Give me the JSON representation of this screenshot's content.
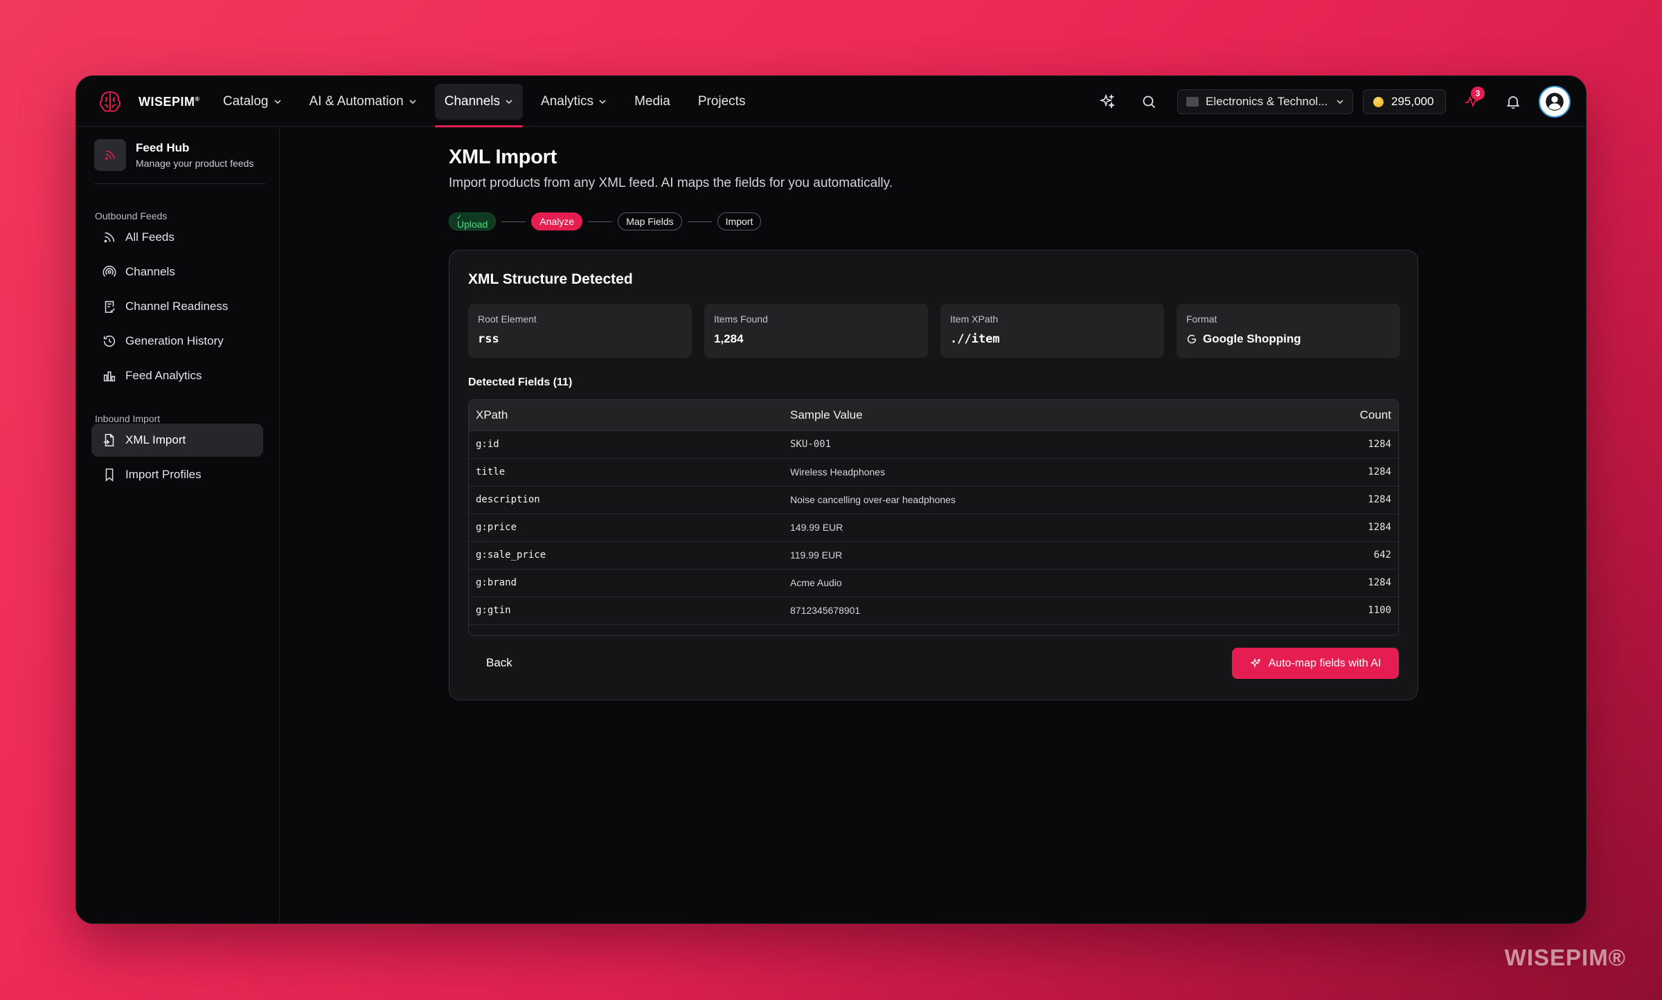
{
  "brand": {
    "name": "WISEPIM",
    "mark": "®"
  },
  "nav": {
    "items": [
      {
        "label": "Catalog",
        "dropdown": true
      },
      {
        "label": "AI & Automation",
        "dropdown": true
      },
      {
        "label": "Channels",
        "dropdown": true,
        "active": true
      },
      {
        "label": "Analytics",
        "dropdown": true
      },
      {
        "label": "Media",
        "dropdown": false
      },
      {
        "label": "Projects",
        "dropdown": false
      }
    ]
  },
  "topbar": {
    "workspace": "Electronics & Technol...",
    "credits": "295,000",
    "activity_badge": "3"
  },
  "sidebar": {
    "hub_title": "Feed Hub",
    "hub_subtitle": "Manage your product feeds",
    "outbound_label": "Outbound Feeds",
    "outbound": [
      {
        "label": "All Feeds",
        "icon": "rss-icon"
      },
      {
        "label": "Channels",
        "icon": "broadcast-icon"
      },
      {
        "label": "Channel Readiness",
        "icon": "clipboard-check-icon"
      },
      {
        "label": "Generation History",
        "icon": "history-icon"
      },
      {
        "label": "Feed Analytics",
        "icon": "bar-chart-icon"
      }
    ],
    "inbound_label": "Inbound Import",
    "inbound": [
      {
        "label": "XML Import",
        "icon": "file-import-icon",
        "active": true
      },
      {
        "label": "Import Profiles",
        "icon": "bookmark-icon"
      }
    ]
  },
  "page": {
    "title": "XML Import",
    "subtitle": "Import products from any XML feed. AI maps the fields for you automatically.",
    "steps": [
      {
        "label": "Upload",
        "state": "done"
      },
      {
        "label": "Analyze",
        "state": "current"
      },
      {
        "label": "Map Fields",
        "state": "pending"
      },
      {
        "label": "Import",
        "state": "pending"
      }
    ]
  },
  "card": {
    "title": "XML Structure Detected",
    "stats": [
      {
        "label": "Root Element",
        "value": "rss"
      },
      {
        "label": "Items Found",
        "value": "1,284"
      },
      {
        "label": "Item XPath",
        "value": ".//item"
      },
      {
        "label": "Format",
        "value": "Google Shopping"
      }
    ],
    "fields_title": "Detected Fields (11)",
    "table": {
      "headers": [
        "XPath",
        "Sample Value",
        "Count"
      ],
      "rows": [
        {
          "xpath": "g:id",
          "sample": "SKU-001",
          "count": "1284"
        },
        {
          "xpath": "title",
          "sample": "Wireless Headphones",
          "count": "1284"
        },
        {
          "xpath": "description",
          "sample": "Noise cancelling over-ear headphones",
          "count": "1284"
        },
        {
          "xpath": "g:price",
          "sample": "149.99 EUR",
          "count": "1284"
        },
        {
          "xpath": "g:sale_price",
          "sample": "119.99 EUR",
          "count": "642"
        },
        {
          "xpath": "g:brand",
          "sample": "Acme Audio",
          "count": "1284"
        },
        {
          "xpath": "g:gtin",
          "sample": "8712345678901",
          "count": "1100"
        }
      ]
    },
    "back_label": "Back",
    "ai_label": "Auto-map fields with AI"
  },
  "watermark": "WISEPIM®",
  "colors": {
    "accent": "#e51d50",
    "success": "#4ade80",
    "window_bg": "#09090b"
  }
}
